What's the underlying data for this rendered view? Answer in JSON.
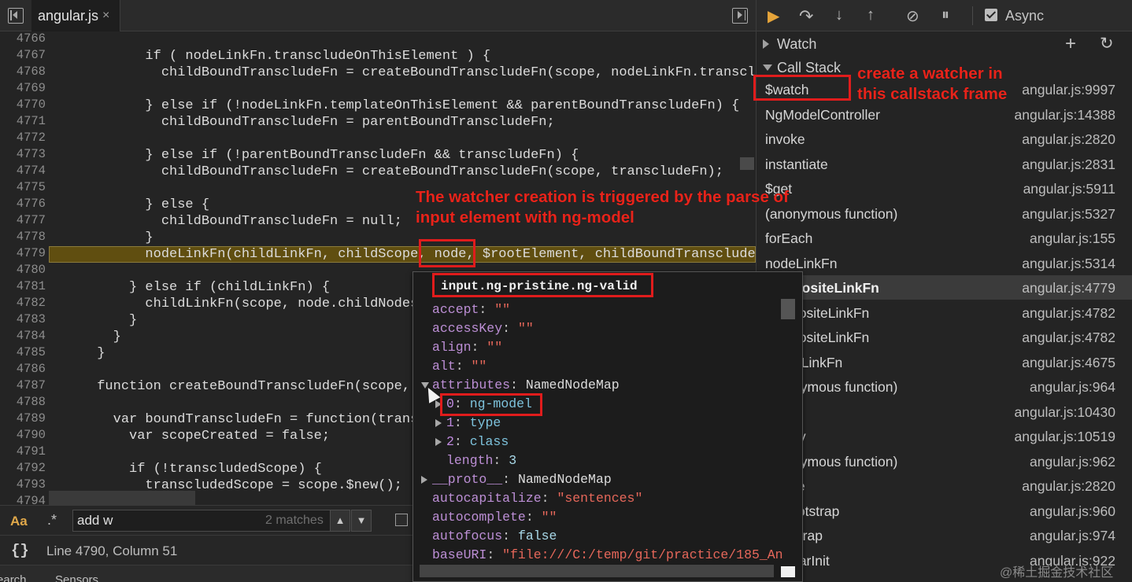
{
  "editor": {
    "tab_label": "angular.js",
    "tab_close": "×",
    "line_numbers": [
      "4766",
      "4767",
      "4768",
      "4769",
      "4770",
      "4771",
      "4772",
      "4773",
      "4774",
      "4775",
      "4776",
      "4777",
      "4778",
      "4779",
      "4780",
      "4781",
      "4782",
      "4783",
      "4784",
      "4785",
      "4786",
      "4787",
      "4788",
      "4789",
      "4790",
      "4791",
      "4792",
      "4793",
      "4794"
    ],
    "code_lines": [
      "",
      "            if ( nodeLinkFn.transcludeOnThisElement ) {",
      "              childBoundTranscludeFn = createBoundTranscludeFn(scope, nodeLinkFn.transclud",
      "",
      "            } else if (!nodeLinkFn.templateOnThisElement && parentBoundTranscludeFn) {",
      "              childBoundTranscludeFn = parentBoundTranscludeFn;",
      "",
      "            } else if (!parentBoundTranscludeFn && transcludeFn) {",
      "              childBoundTranscludeFn = createBoundTranscludeFn(scope, transcludeFn);",
      "",
      "            } else {",
      "              childBoundTranscludeFn = null;",
      "            }",
      "            nodeLinkFn(childLinkFn, childScope, node, $rootElement, childBoundTranscludeFn",
      "",
      "          } else if (childLinkFn) {",
      "            childLinkFn(scope, node.childNodes",
      "          }",
      "        }",
      "      }",
      "",
      "      function createBoundTranscludeFn(scope, tr",
      "",
      "        var boundTranscludeFn = function(transcl",
      "          var scopeCreated = false;",
      "",
      "          if (!transcludedScope) {",
      "            transcludedScope = scope.$new();"
    ],
    "search": {
      "case_label": "Aa",
      "regex_label": ".*",
      "value": "add w",
      "match_count": "2 matches"
    },
    "status": {
      "braces": "{}",
      "cursor_position": "Line 4790, Column 51"
    },
    "bottom_tabs": [
      "Search",
      "Sensors"
    ]
  },
  "debugger": {
    "async_label": "Async",
    "watch_title": "Watch",
    "watch_add": "+",
    "watch_refresh": "↻",
    "call_stack_title": "Call Stack",
    "frames": [
      {
        "name": "$watch",
        "loc": "angular.js:9997"
      },
      {
        "name": "NgModelController",
        "loc": "angular.js:14388"
      },
      {
        "name": "invoke",
        "loc": "angular.js:2820"
      },
      {
        "name": "instantiate",
        "loc": "angular.js:2831"
      },
      {
        "name": "$get",
        "loc": "angular.js:5911"
      },
      {
        "name": "(anonymous function)",
        "loc": "angular.js:5327"
      },
      {
        "name": "forEach",
        "loc": "angular.js:155"
      },
      {
        "name": "nodeLinkFn",
        "loc": "angular.js:5314"
      },
      {
        "name": "compositeLinkFn",
        "loc": "angular.js:4779"
      },
      {
        "name": "compositeLinkFn",
        "loc": "angular.js:4782"
      },
      {
        "name": "compositeLinkFn",
        "loc": "angular.js:4782"
      },
      {
        "name": "publicLinkFn",
        "loc": "angular.js:4675"
      },
      {
        "name": "(anonymous function)",
        "loc": "angular.js:964"
      },
      {
        "name": "$eval",
        "loc": "angular.js:10430"
      },
      {
        "name": "$apply",
        "loc": "angular.js:10519"
      },
      {
        "name": "(anonymous function)",
        "loc": "angular.js:962"
      },
      {
        "name": "invoke",
        "loc": "angular.js:2820"
      },
      {
        "name": "doBootstrap",
        "loc": "angular.js:960"
      },
      {
        "name": "bootstrap",
        "loc": "angular.js:974"
      },
      {
        "name": "angularInit",
        "loc": "angular.js:922"
      }
    ]
  },
  "popover": {
    "title": "input.ng-pristine.ng-valid",
    "props": [
      {
        "key": "accept",
        "value": "\"\"",
        "kind": "string"
      },
      {
        "key": "accessKey",
        "value": "\"\"",
        "kind": "string"
      },
      {
        "key": "align",
        "value": "\"\"",
        "kind": "string"
      },
      {
        "key": "alt",
        "value": "\"\"",
        "kind": "string"
      },
      {
        "key": "attributes",
        "value": "NamedNodeMap",
        "kind": "object"
      },
      {
        "key": "0",
        "value": "ng-model",
        "kind": "attr"
      },
      {
        "key": "1",
        "value": "type",
        "kind": "attr"
      },
      {
        "key": "2",
        "value": "class",
        "kind": "attr"
      },
      {
        "key": "length",
        "value": "3",
        "kind": "plain"
      },
      {
        "key": "__proto__",
        "value": "NamedNodeMap",
        "kind": "object"
      },
      {
        "key": "autocapitalize",
        "value": "\"sentences\"",
        "kind": "string"
      },
      {
        "key": "autocomplete",
        "value": "\"\"",
        "kind": "string"
      },
      {
        "key": "autofocus",
        "value": "false",
        "kind": "plain"
      },
      {
        "key": "baseURI",
        "value": "\"file:///C:/temp/git/practice/185_An",
        "kind": "string"
      }
    ]
  },
  "annotations": {
    "watcher_note": [
      "create a watcher in",
      "this callstack frame"
    ],
    "trigger_note": [
      "The watcher creation is triggered by the parse of",
      "input element with ng-model"
    ]
  },
  "watermark": "@稀土掘金技术社区",
  "colors": {
    "annotation_red": "#e01c1c",
    "highlight_line": "#604e10",
    "keyword_blue": "#5d9dd4",
    "resume_orange": "#e5a43a"
  }
}
